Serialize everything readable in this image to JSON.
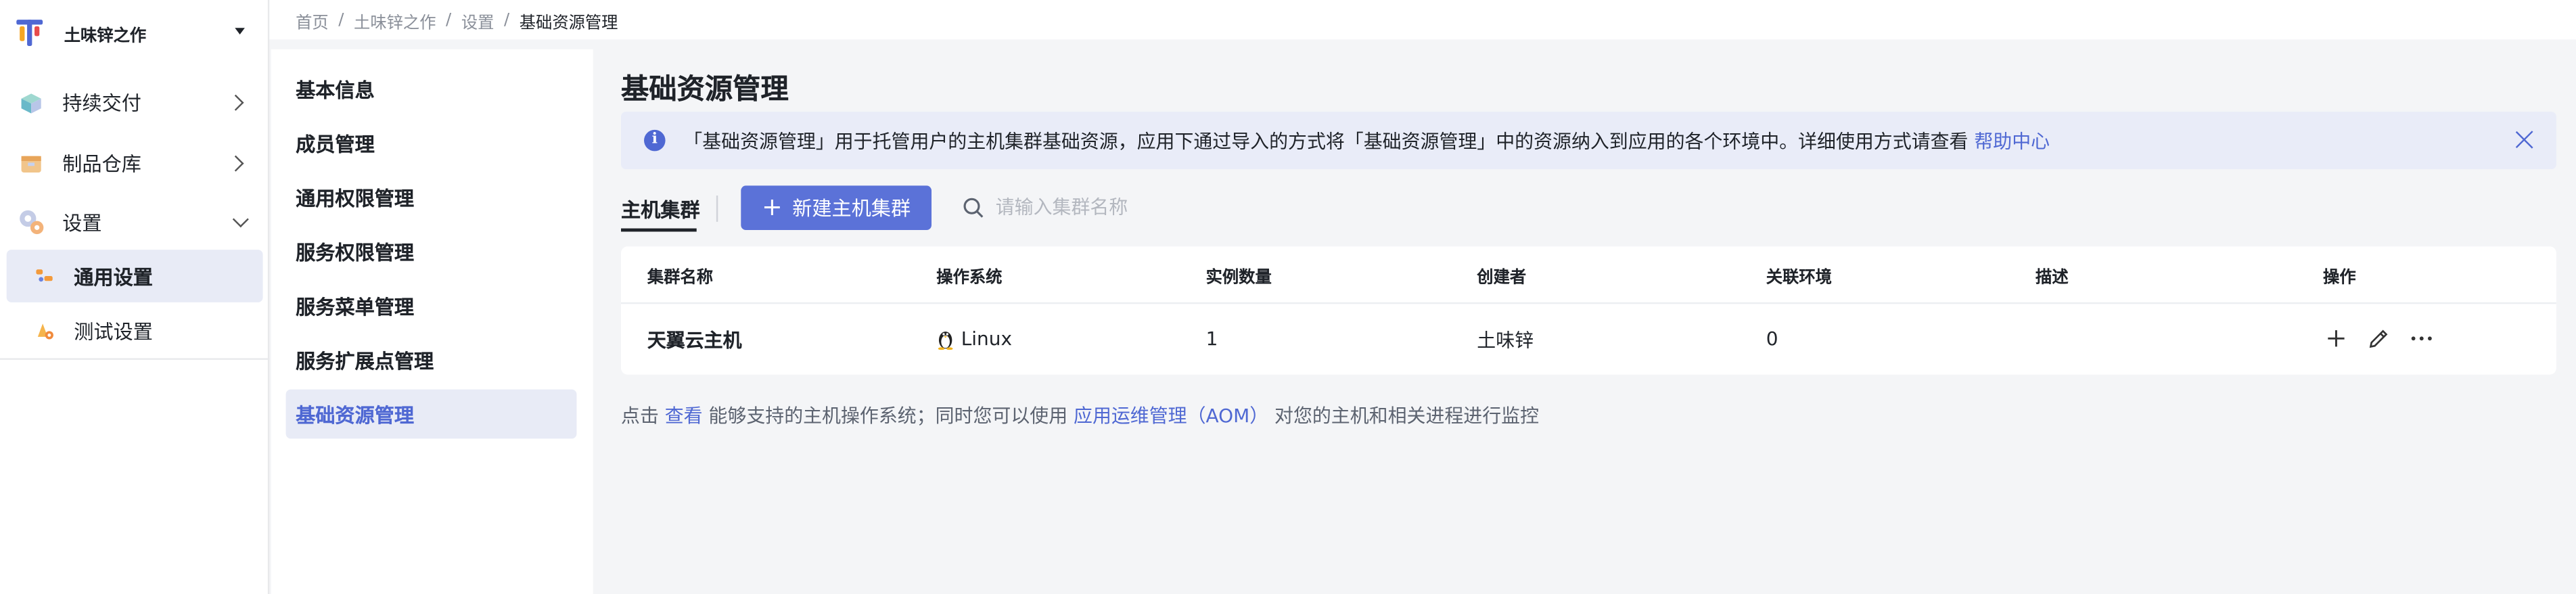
{
  "brand": {
    "name": "土味锌之作"
  },
  "sidebar": {
    "items": [
      {
        "label": "持续交付",
        "icon": "delivery-icon"
      },
      {
        "label": "制品仓库",
        "icon": "artifact-icon"
      },
      {
        "label": "设置",
        "icon": "settings-icon"
      }
    ],
    "sub_items": [
      {
        "label": "通用设置",
        "icon": "general-settings-icon",
        "active": true
      },
      {
        "label": "测试设置",
        "icon": "test-settings-icon",
        "active": false
      }
    ]
  },
  "breadcrumb": {
    "items": [
      "首页",
      "土味锌之作",
      "设置"
    ],
    "current": "基础资源管理",
    "separator": "/"
  },
  "settings_menu": {
    "items": [
      "基本信息",
      "成员管理",
      "通用权限管理",
      "服务权限管理",
      "服务菜单管理",
      "服务扩展点管理",
      "基础资源管理"
    ],
    "active_index": 6
  },
  "page": {
    "title": "基础资源管理",
    "info": {
      "text": "「基础资源管理」用于托管用户的主机集群基础资源，应用下通过导入的方式将「基础资源管理」中的资源纳入到应用的各个环境中。详细使用方式请查看",
      "link": "帮助中心"
    }
  },
  "toolbar": {
    "tab": "主机集群",
    "new_button": "新建主机集群",
    "search_placeholder": "请输入集群名称"
  },
  "table": {
    "columns": [
      "集群名称",
      "操作系统",
      "实例数量",
      "创建者",
      "关联环境",
      "描述",
      "操作"
    ],
    "rows": [
      {
        "name": "天翼云主机",
        "os": "Linux",
        "instances": "1",
        "creator": "土味锌",
        "env": "0",
        "desc": ""
      }
    ]
  },
  "footnote": {
    "p1": "点击",
    "link1": "查看",
    "p2": "能够支持的主机操作系统；同时您可以使用",
    "link2": "应用运维管理（AOM）",
    "p3": "对您的主机和相关进程进行监控"
  },
  "colors": {
    "accent": "#5b72d8",
    "active_bg": "#e8ebf6",
    "info_bg": "#e9ecf8"
  }
}
